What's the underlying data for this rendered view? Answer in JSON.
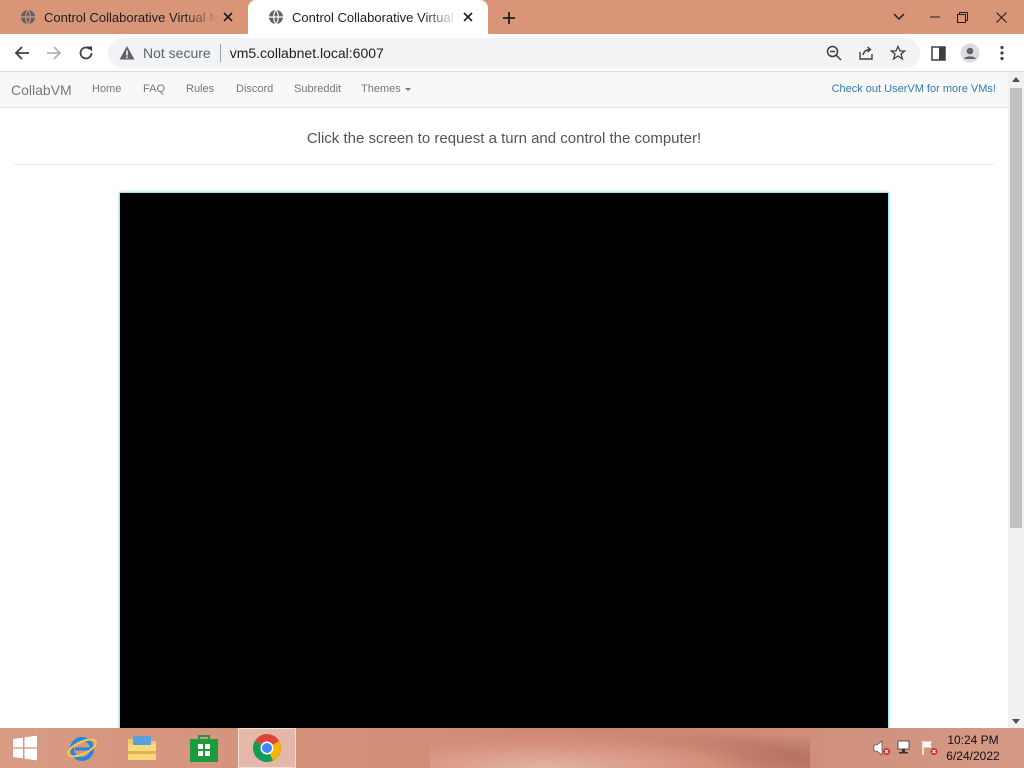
{
  "browser": {
    "tabs": [
      {
        "title": "Control Collaborative Virtual Machine",
        "active": false
      },
      {
        "title": "Control Collaborative Virtual Machine",
        "active": true
      }
    ],
    "address": {
      "security_label": "Not secure",
      "url": "vm5.collabnet.local:6007"
    }
  },
  "site": {
    "brand": "CollabVM",
    "nav": [
      {
        "label": "Home"
      },
      {
        "label": "FAQ"
      },
      {
        "label": "Rules"
      },
      {
        "label": "Discord"
      },
      {
        "label": "Subreddit"
      },
      {
        "label": "Themes"
      }
    ],
    "nav_right": "Check out UserVM for more VMs!",
    "prompt": "Click the screen to request a turn and control the computer!"
  },
  "taskbar": {
    "apps": [
      {
        "icon": "internet-explorer-icon"
      },
      {
        "icon": "file-explorer-icon"
      },
      {
        "icon": "store-icon"
      },
      {
        "icon": "chrome-icon"
      }
    ],
    "clock": {
      "time": "10:24 PM",
      "date": "6/24/2022"
    }
  },
  "colors": {
    "tabstrip": "#d99578",
    "taskbar": "#d28e76",
    "vm_border": "#9fe4ea",
    "link": "#337ab7"
  }
}
